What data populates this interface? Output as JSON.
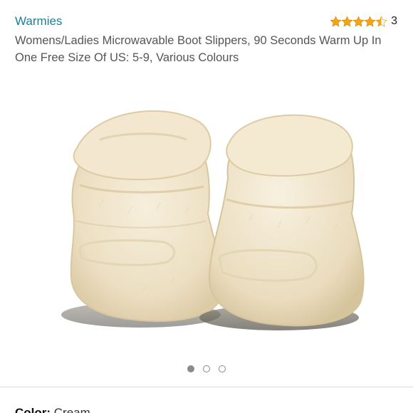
{
  "product": {
    "brand": "Warmies",
    "title": "Womens/Ladies Microwavable Boot Slippers, 90 Seconds Warm Up In One Free Size Of US: 5-9, Various Colours",
    "rating": {
      "stars": 4.5,
      "count": "3",
      "icon": "star-icon",
      "color": "#f0a41b"
    },
    "image": {
      "alt": "Cream fluffy microwavable boot slippers"
    },
    "carousel": {
      "total": 3,
      "active_index": 0
    },
    "color_label": "Color:",
    "color_value": "Cream"
  },
  "colors": {
    "link": "#1b7f98",
    "star": "#f0a41b",
    "text_secondary": "#555555"
  }
}
